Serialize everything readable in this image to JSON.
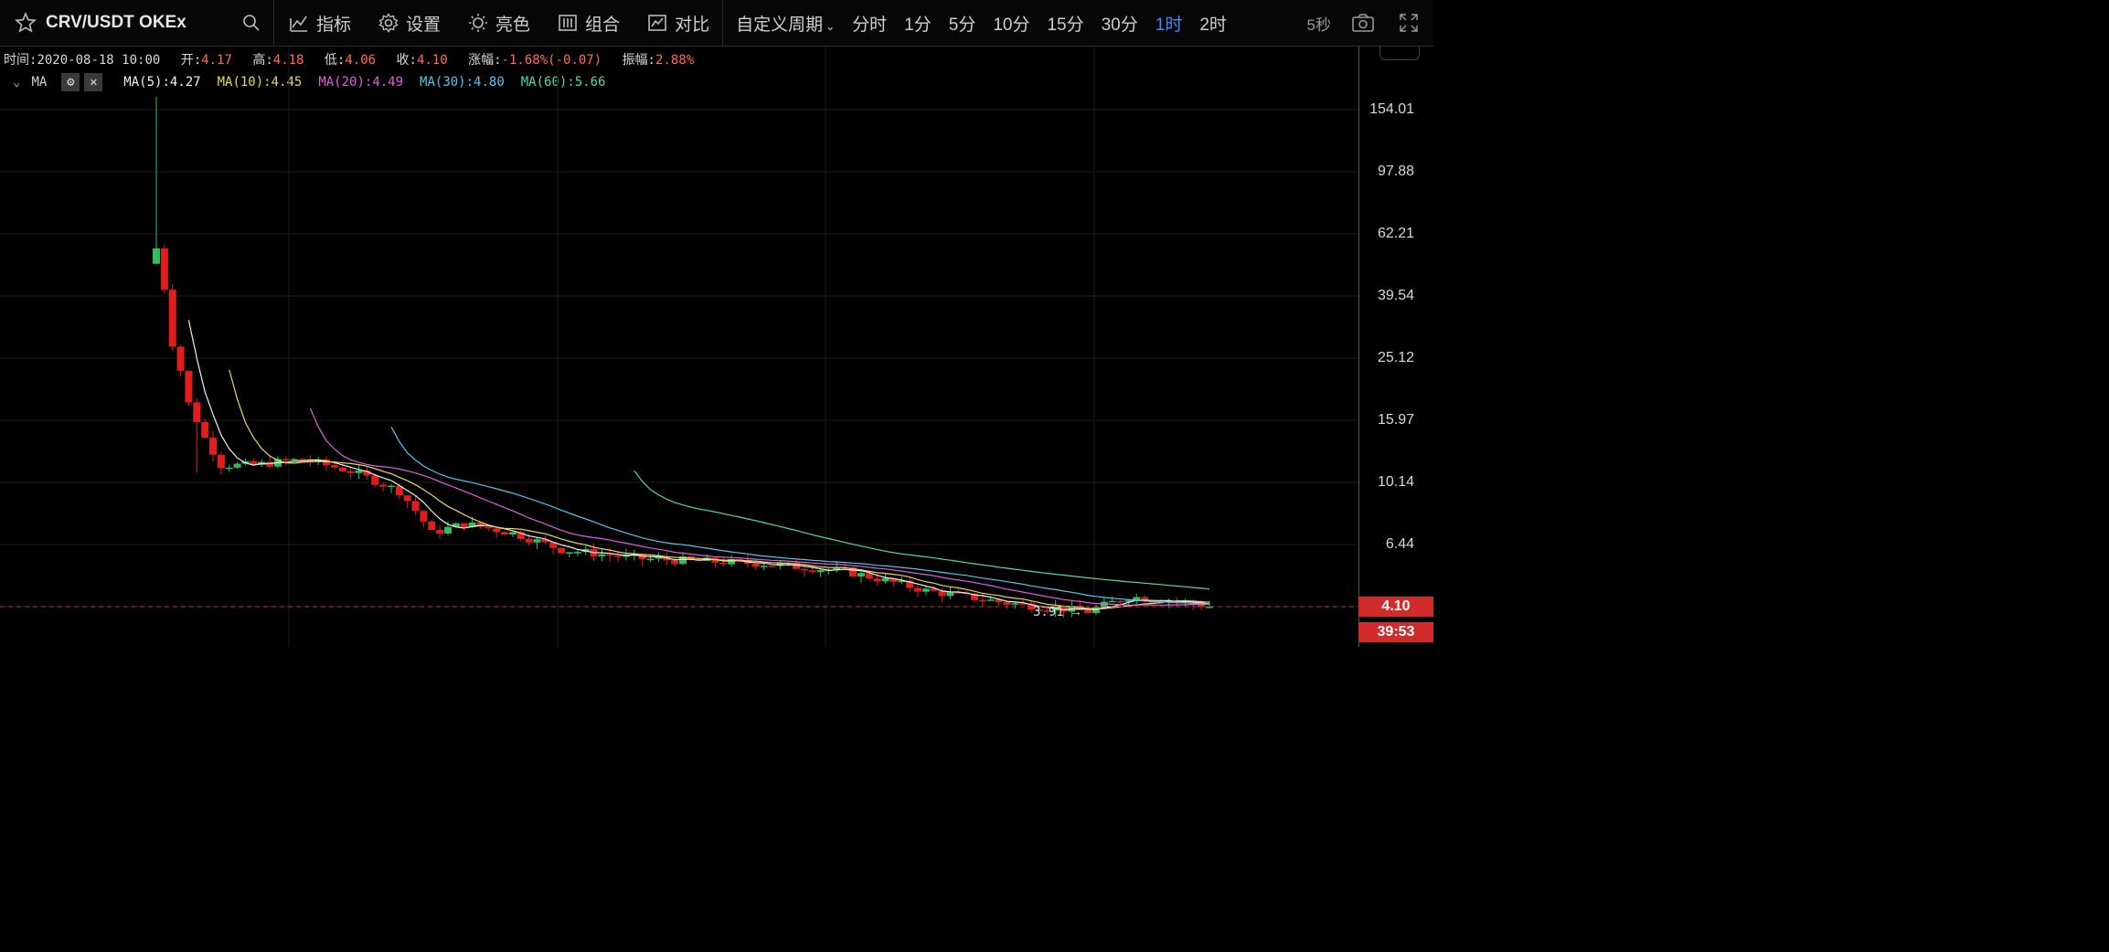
{
  "toolbar": {
    "symbol": "CRV/USDT OKEx",
    "tools": [
      {
        "label": "指标",
        "icon": "indicator-icon"
      },
      {
        "label": "设置",
        "icon": "gear-icon"
      },
      {
        "label": "亮色",
        "icon": "sun-icon"
      },
      {
        "label": "组合",
        "icon": "layout-icon"
      },
      {
        "label": "对比",
        "icon": "compare-icon"
      }
    ],
    "custom_period": "自定义周期",
    "periods": [
      "分时",
      "1分",
      "5分",
      "10分",
      "15分",
      "30分",
      "1时",
      "2时"
    ],
    "active_period": "1时",
    "refresh": "5秒"
  },
  "info": {
    "time_label": "时间:",
    "time": "2020-08-18 10:00",
    "open_label": "开:",
    "open": "4.17",
    "high_label": "高:",
    "high": "4.18",
    "low_label": "低:",
    "low": "4.06",
    "close_label": "收:",
    "close": "4.10",
    "change_label": "涨幅:",
    "change": "-1.68%(-0.07)",
    "amp_label": "振幅:",
    "amp": "2.88%"
  },
  "ma": {
    "label": "MA",
    "items": [
      {
        "text": "MA(5):4.27",
        "color": "#f0f0f0"
      },
      {
        "text": "MA(10):4.45",
        "color": "#e8d95a"
      },
      {
        "text": "MA(20):4.49",
        "color": "#e05ce0"
      },
      {
        "text": "MA(30):4.80",
        "color": "#52c6ee"
      },
      {
        "text": "MA(60):5.66",
        "color": "#4fdc9a"
      }
    ]
  },
  "axis": {
    "ticks": [
      "154.01",
      "97.88",
      "62.21",
      "39.54",
      "25.12",
      "15.97",
      "10.14",
      "6.44"
    ],
    "current_price": "4.10",
    "countdown": "39:53",
    "low_marker": "3.91"
  },
  "colors": {
    "up": "#2fbf5a",
    "down": "#e01e1e",
    "price_line": "#d12b2b"
  }
}
